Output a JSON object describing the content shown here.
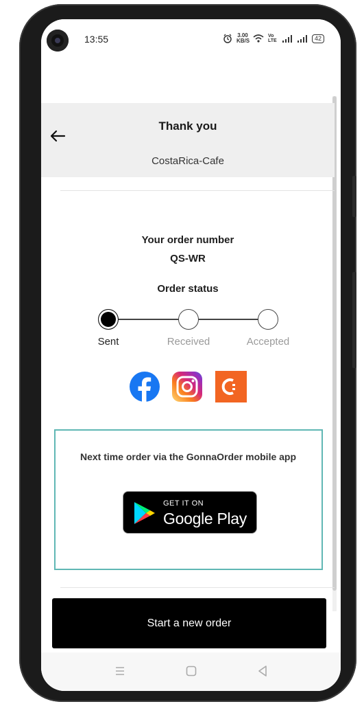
{
  "status_bar": {
    "time": "13:55",
    "net_speed": "3.00 KB/S",
    "volte": "Vo LTE",
    "battery": "42"
  },
  "header": {
    "title": "Thank you",
    "subtitle": "CostaRica-Cafe"
  },
  "order": {
    "number_label": "Your order number",
    "number": "QS-WR",
    "status_label": "Order status",
    "steps": [
      {
        "label": "Sent",
        "active": true
      },
      {
        "label": "Received",
        "active": false
      },
      {
        "label": "Accepted",
        "active": false
      }
    ]
  },
  "social": [
    {
      "name": "facebook",
      "color": "#1877f2"
    },
    {
      "name": "instagram",
      "color": "#c13584"
    },
    {
      "name": "gonnaorder",
      "color": "#f26522"
    }
  ],
  "promo": {
    "text": "Next time order via the GonnaOrder mobile app",
    "store_small": "GET IT ON",
    "store_big": "Google Play",
    "border_color": "#5fb7b4"
  },
  "actions": {
    "start_new_order": "Start a new order"
  },
  "nav": [
    "menu-icon",
    "home-icon",
    "back-icon"
  ]
}
